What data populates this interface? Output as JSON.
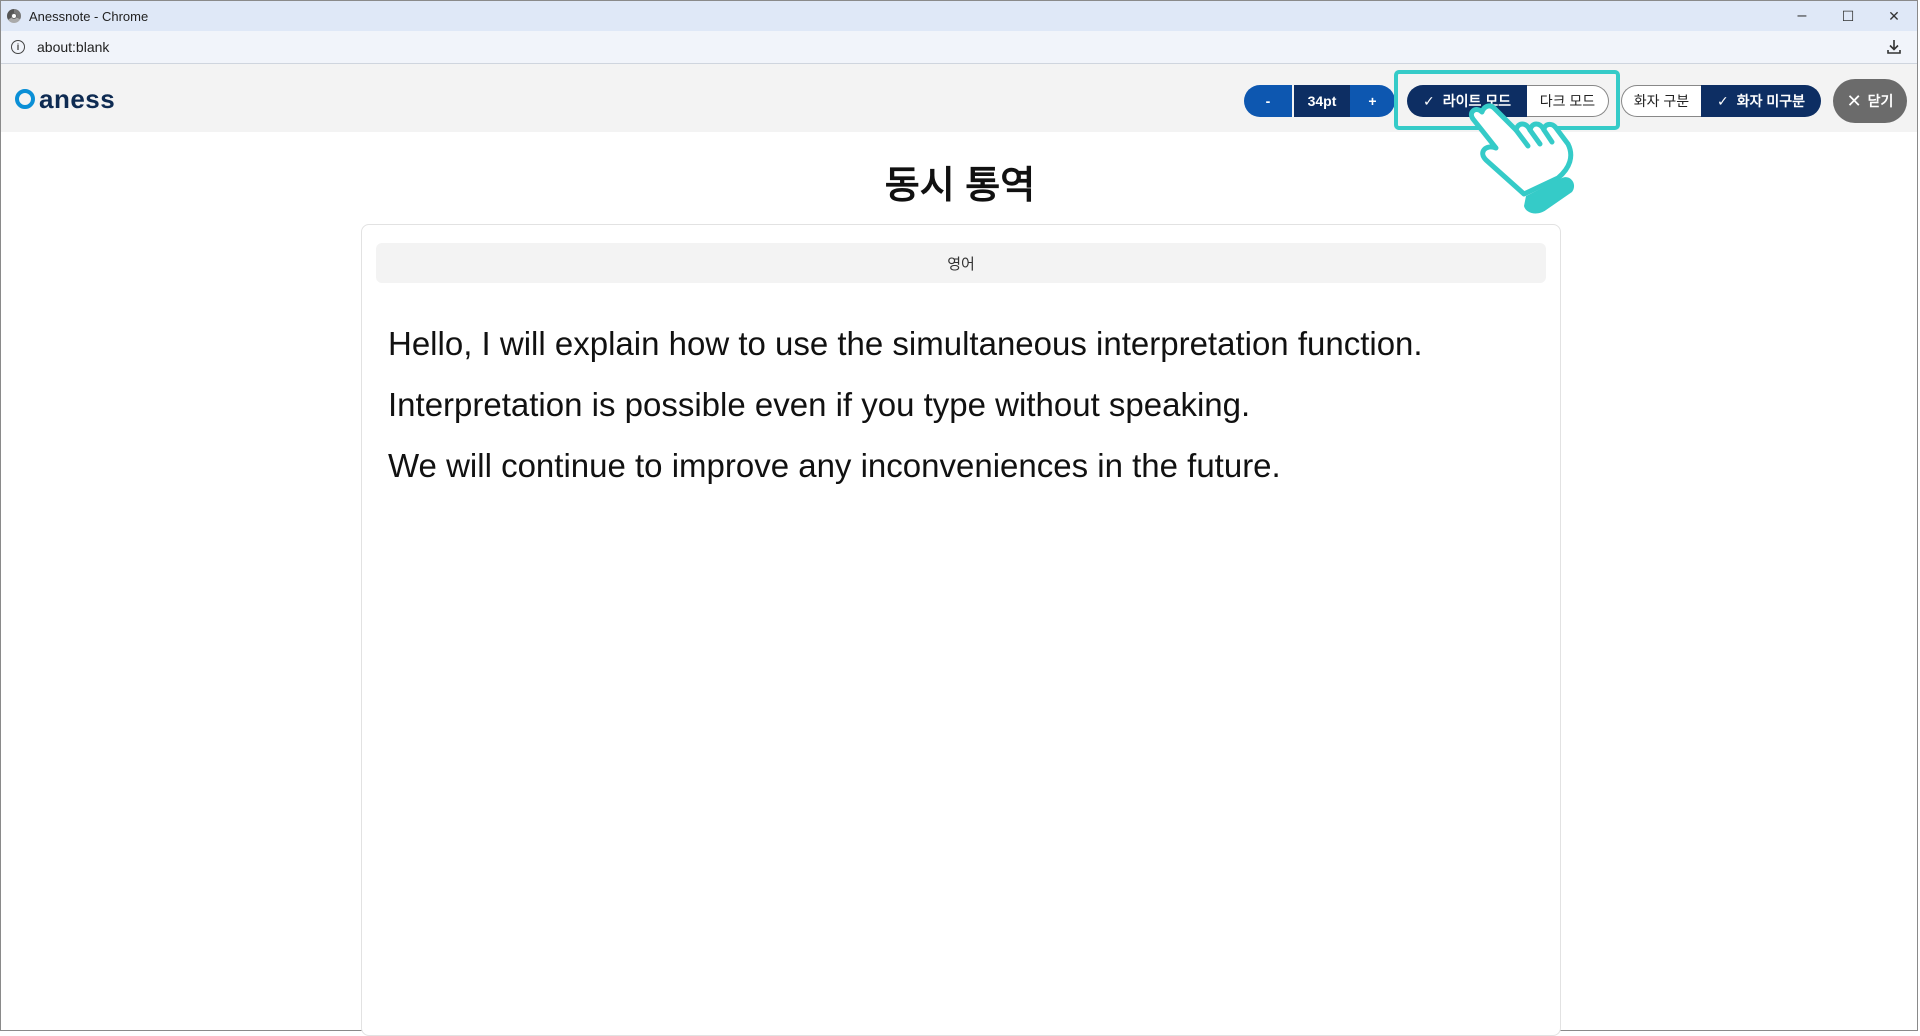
{
  "window": {
    "title": "Anessnote - Chrome",
    "controls": {
      "minimize": "–",
      "maximize": "☐",
      "close": "✕"
    }
  },
  "addressbar": {
    "url": "about:blank"
  },
  "header": {
    "logo_text": "aness",
    "font_size": {
      "decrease_label": "-",
      "value": "34pt",
      "increase_label": "+"
    },
    "theme": {
      "light_label": "라이트 모드",
      "dark_label": "다크 모드",
      "selected": "light"
    },
    "speaker": {
      "split_label": "화자 구분",
      "nosplit_label": "화자 미구분",
      "selected": "nosplit"
    },
    "close_label": "닫기"
  },
  "main": {
    "title": "동시 통역",
    "language": "영어",
    "lines": [
      "Hello, I will explain how to use the simultaneous interpretation function.",
      "Interpretation is possible even if you type without speaking.",
      "We will continue to improve any inconveniences in the future."
    ]
  },
  "colors": {
    "primary_dark": "#0d2e63",
    "primary": "#0d57b0",
    "highlight": "#35cbc8",
    "logo_ring": "#0a8fd6"
  }
}
